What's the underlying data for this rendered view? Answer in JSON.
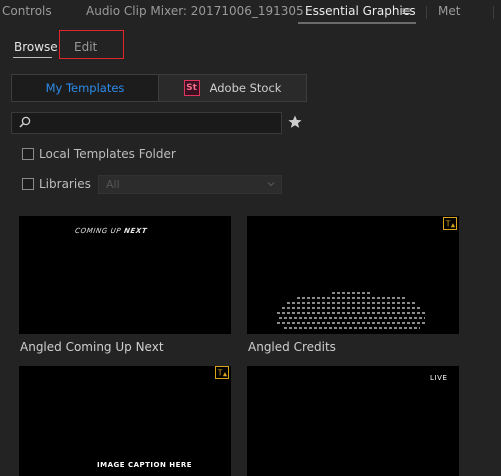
{
  "panel_tabs": {
    "controls": "Controls",
    "audio_clip_mixer": "Audio Clip Mixer: 20171006_191305",
    "essential_graphics": "Essential Graphics",
    "menu_glyph": "≡",
    "metadata_truncated": "Met"
  },
  "mode_tabs": {
    "browse": "Browse",
    "edit": "Edit"
  },
  "source_toggle": {
    "my_templates": "My Templates",
    "adobe_stock_badge": "St",
    "adobe_stock": "Adobe Stock"
  },
  "search": {
    "value": "",
    "icon": "search-icon",
    "favorite_icon": "star-icon"
  },
  "filters": {
    "local_templates_folder": "Local Templates Folder",
    "libraries": "Libraries",
    "libraries_select_value": "All"
  },
  "templates": [
    {
      "label": "Angled Coming Up Next",
      "thumbnail_text_regular": "COMING UP ",
      "thumbnail_text_bold": "NEXT",
      "warning_badge": false
    },
    {
      "label": "Angled Credits",
      "warning_badge": true
    },
    {
      "label": "",
      "thumbnail_text": "IMAGE CAPTION HERE",
      "warning_badge": true
    },
    {
      "label": "",
      "thumbnail_text": "LIVE",
      "warning_badge": false
    }
  ],
  "colors": {
    "background": "#232323",
    "accent_blue": "#2d8ceb",
    "highlight_red": "#e0262b",
    "stock_pink": "#e0335d",
    "warning_yellow": "#d9a31a"
  }
}
